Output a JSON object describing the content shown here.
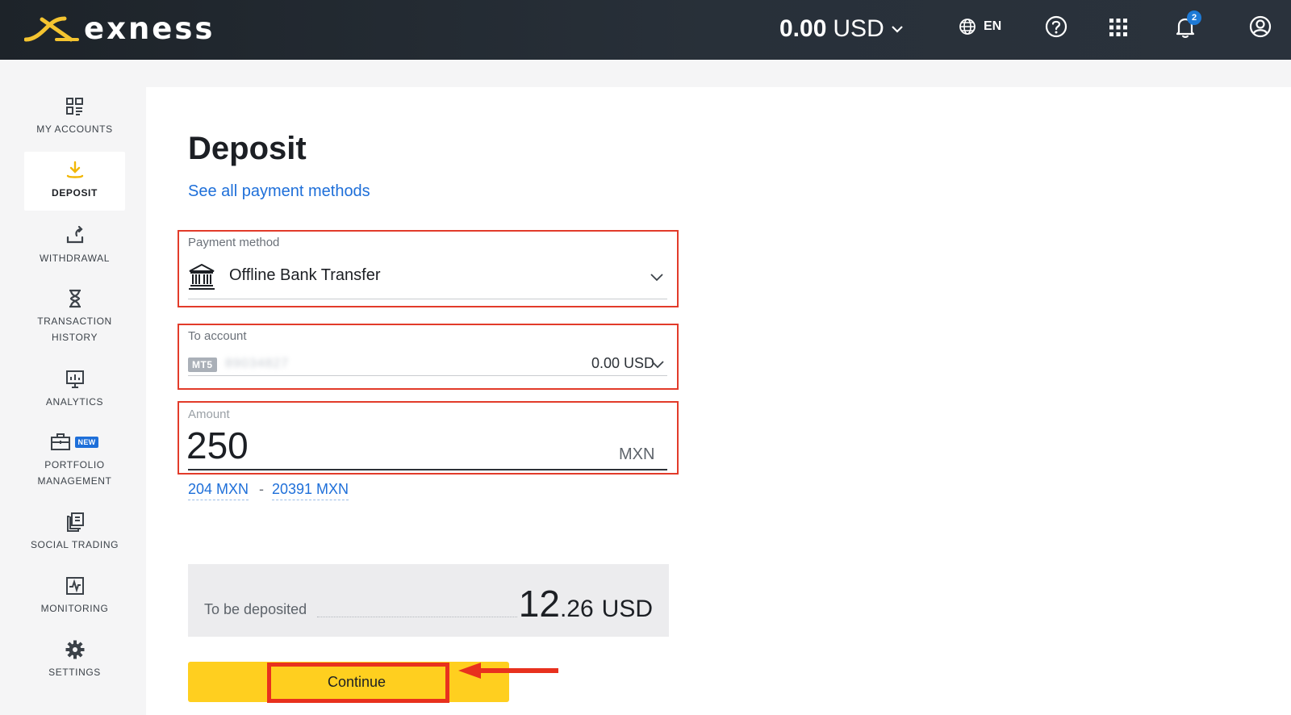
{
  "header": {
    "brand": "exness",
    "balance_amount": "0.00",
    "balance_currency": "USD",
    "language": "EN",
    "notification_count": "2"
  },
  "sidebar": {
    "items": [
      {
        "label": "MY ACCOUNTS",
        "icon": "grid-list-icon",
        "active": false
      },
      {
        "label": "DEPOSIT",
        "icon": "download-icon",
        "active": true
      },
      {
        "label": "WITHDRAWAL",
        "icon": "upload-icon",
        "active": false
      },
      {
        "label_line1": "TRANSACTION",
        "label_line2": "HISTORY",
        "icon": "hourglass-icon",
        "active": false
      },
      {
        "label": "ANALYTICS",
        "icon": "analytics-icon",
        "active": false
      },
      {
        "label_line1": "PORTFOLIO",
        "label_line2": "MANAGEMENT",
        "icon": "briefcase-icon",
        "badge": "NEW",
        "active": false
      },
      {
        "label": "SOCIAL TRADING",
        "icon": "copy-icon",
        "active": false
      },
      {
        "label": "MONITORING",
        "icon": "monitor-chart-icon",
        "active": false
      },
      {
        "label": "SETTINGS",
        "icon": "gear-icon",
        "active": false
      }
    ]
  },
  "main": {
    "title": "Deposit",
    "see_all_link": "See all payment methods",
    "payment_method": {
      "label": "Payment method",
      "value": "Offline Bank Transfer",
      "icon": "bank-icon"
    },
    "to_account": {
      "label": "To account",
      "platform": "MT5",
      "account_number": "89034827",
      "balance": "0.00 USD"
    },
    "amount": {
      "label": "Amount",
      "value": "250",
      "currency": "MXN"
    },
    "limits": {
      "min": "204 MXN",
      "separator": "-",
      "max": "20391 MXN"
    },
    "summary": {
      "label": "To be deposited",
      "integer": "12",
      "decimal": ".26",
      "currency": "USD"
    },
    "continue_label": "Continue"
  },
  "colors": {
    "header_bg": "#232a31",
    "accent_yellow": "#ffcf1f",
    "link_blue": "#1e6fd9",
    "highlight_red": "#e23b2a"
  }
}
